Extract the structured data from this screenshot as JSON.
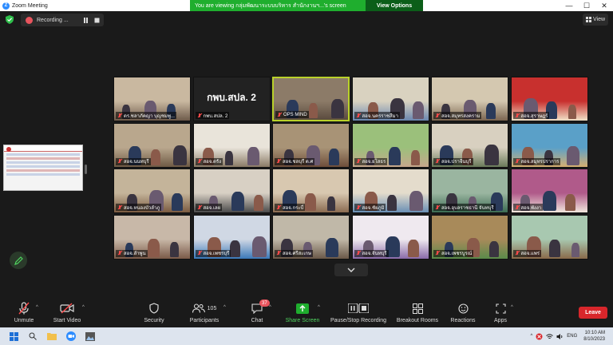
{
  "window": {
    "title": "Zoom Meeting",
    "minimize": "—",
    "maximize": "☐",
    "close": "✕"
  },
  "share_banner": {
    "message": "You are viewing กลุ่มพัฒนาระบบบริหาร สำนักงานฯ...'s screen",
    "view_options": "View Options"
  },
  "recording": {
    "label": "Recording ..."
  },
  "view_button": {
    "label": "View"
  },
  "participants": [
    {
      "name": "ดร.ชลาภัคญา บุญชมพู...",
      "muted": true
    },
    {
      "name": "กพบ.สปล. 2",
      "muted": true,
      "big_label": "กพบ.สปล. 2"
    },
    {
      "name": "OPS MIND",
      "muted": true,
      "active": true
    },
    {
      "name": "สอจ.นครราชสีมา",
      "muted": true
    },
    {
      "name": "สอจ.สมุทรสงคราม",
      "muted": true
    },
    {
      "name": "สอจ.สุราษฎร์",
      "muted": true
    },
    {
      "name": "สอจ.นนทบุรี",
      "muted": true
    },
    {
      "name": "สอจ.ตรัง",
      "muted": true
    },
    {
      "name": "สอจ.ชลบุรี ต.ศ",
      "muted": true
    },
    {
      "name": "สอจ.ยโสธร",
      "muted": true
    },
    {
      "name": "สอจ.ปราจีนบุรี",
      "muted": true
    },
    {
      "name": "สอจ.สมุทรปราการ",
      "muted": true
    },
    {
      "name": "สอจ.หนองบัวลำภู",
      "muted": true
    },
    {
      "name": "สอจ.เลย",
      "muted": true
    },
    {
      "name": "สอจ.กระบี่",
      "muted": true
    },
    {
      "name": "สอจ.ชัยภูมิ",
      "muted": true
    },
    {
      "name": "สอจ.อุบลราชธานี จันทบุรี",
      "muted": true
    },
    {
      "name": "สอจ.พังงา",
      "muted": true
    },
    {
      "name": "สอจ.ลำพูน",
      "muted": true
    },
    {
      "name": "สอจ.เพชรบุรี",
      "muted": true
    },
    {
      "name": "สอจ.ศรีสะเกษ",
      "muted": true
    },
    {
      "name": "สอจ.จันทบุรี",
      "muted": true
    },
    {
      "name": "สอจ.เพชรบูรณ์",
      "muted": true
    },
    {
      "name": "สอจ.แพร่",
      "muted": true
    }
  ],
  "toolbar": {
    "unmute": "Unmute",
    "start_video": "Start Video",
    "security": "Security",
    "participants": "Participants",
    "participants_count": "105",
    "chat": "Chat",
    "chat_badge": "37",
    "share_screen": "Share Screen",
    "recording": "Pause/Stop Recording",
    "breakout": "Breakout Rooms",
    "reactions": "Reactions",
    "apps": "Apps",
    "leave": "Leave"
  },
  "taskbar": {
    "lang": "ENG",
    "time": "10:10 AM",
    "date": "8/10/2023"
  },
  "colors": {
    "zoom_blue": "#2d8cff",
    "banner_green": "#1fae2e",
    "leave_red": "#d8262b",
    "active_border": "#b9d12a"
  }
}
